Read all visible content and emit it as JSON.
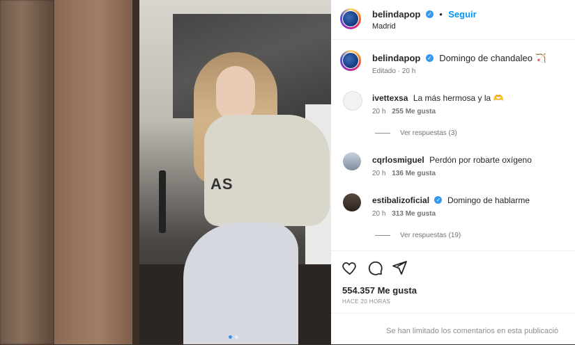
{
  "post": {
    "author": "belindapop",
    "follow_label": "Seguir",
    "separator": "•",
    "location": "Madrid",
    "caption": "Domingo de chandaleo 🏹",
    "caption_meta": "Editado · 20 h",
    "photo_text": "AS",
    "next_icon": "›"
  },
  "comments": [
    {
      "user": "ivettexsa",
      "text": "La más hermosa y la 🫶",
      "time": "20 h",
      "likes": "255 Me gusta",
      "replies": "Ver respuestas (3)",
      "verified": false
    },
    {
      "user": "cqrlosmiguel",
      "text": "Perdón por robarte oxígeno",
      "time": "20 h",
      "likes": "136 Me gusta",
      "replies": "",
      "verified": false
    },
    {
      "user": "estibalizoficial",
      "text": "Domingo de hablarme",
      "time": "20 h",
      "likes": "313 Me gusta",
      "replies": "Ver respuestas (19)",
      "verified": true
    }
  ],
  "stats": {
    "likes": "554.357 Me gusta",
    "posted": "HACE 20 HORAS",
    "limited": "Se han limitado los comentarios en esta publicació"
  },
  "icons": [
    "heart-icon",
    "comment-icon",
    "share-icon",
    "verified-icon",
    "chevron-right-icon"
  ]
}
